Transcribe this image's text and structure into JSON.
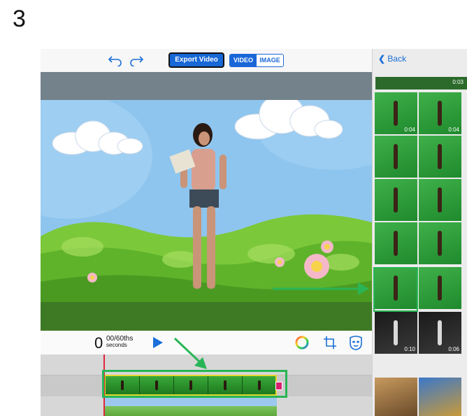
{
  "step_number": "3",
  "toolbar": {
    "undo_icon": "undo-icon",
    "redo_icon": "redo-icon",
    "export_label": "Export Video",
    "mode_video_label": "VIDEO",
    "mode_image_label": "IMAGE",
    "selected_mode": "VIDEO"
  },
  "controls": {
    "time_value": "0",
    "time_fraction": "00/60ths",
    "time_unit": "seconds",
    "play_icon": "play-icon",
    "color_icon": "color-wheel-icon",
    "crop_icon": "crop-icon",
    "mask_icon": "mask-icon"
  },
  "panel": {
    "back_label": "Back",
    "back_icon": "chevron-left-icon",
    "top_strip_duration": "0:03",
    "thumbnails": [
      {
        "duration": "0:04",
        "kind": "green"
      },
      {
        "duration": "0:04",
        "kind": "green"
      },
      {
        "duration": "",
        "kind": "green"
      },
      {
        "duration": "",
        "kind": "green"
      },
      {
        "duration": "",
        "kind": "green"
      },
      {
        "duration": "",
        "kind": "green"
      },
      {
        "duration": "",
        "kind": "green"
      },
      {
        "duration": "",
        "kind": "green"
      },
      {
        "duration": "",
        "kind": "green"
      },
      {
        "duration": "",
        "kind": "green"
      },
      {
        "duration": "0:10",
        "kind": "dark"
      },
      {
        "duration": "0:06",
        "kind": "dark"
      }
    ]
  },
  "colors": {
    "accent": "#1a6fd8",
    "highlight": "#29b555",
    "playhead": "#e0243b",
    "clip_border": "#e5d82f"
  }
}
